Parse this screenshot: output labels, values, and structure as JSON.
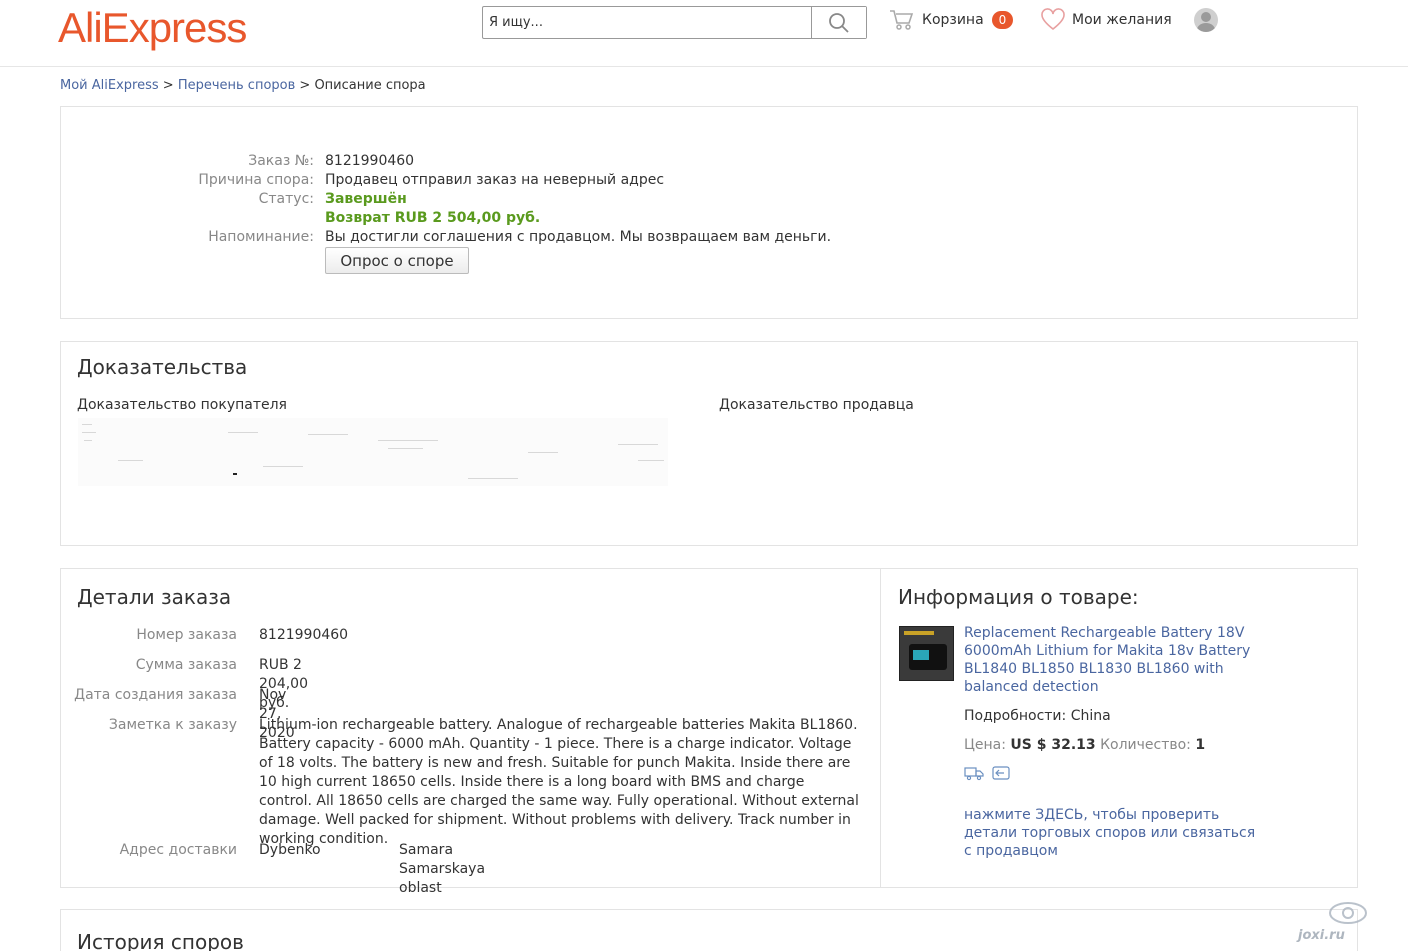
{
  "header": {
    "logo": "AliExpress",
    "search_placeholder": "Я ищу...",
    "cart_label": "Корзина",
    "cart_count": "0",
    "wishlist_label": "Мои желания"
  },
  "breadcrumb": {
    "item1": "Мой AliExpress",
    "sep1": " > ",
    "item2": "Перечень споров",
    "sep2": " > ",
    "current": "Описание спора"
  },
  "dispute": {
    "order_label": "Заказ №:",
    "order_value": "8121990460",
    "reason_label": "Причина спора:",
    "reason_value": "Продавец отправил заказ на неверный адрес",
    "status_label": "Статус:",
    "status_value": "Завершён",
    "refund_value": "Возврат RUB 2 504,00 руб.",
    "reminder_label": "Напоминание:",
    "reminder_value": "Вы достигли соглашения с продавцом. Мы возвращаем вам деньги.",
    "survey_button": "Опрос о споре"
  },
  "evidence": {
    "title": "Доказательства",
    "buyer_label": "Доказательство покупателя",
    "seller_label": "Доказательство продавца"
  },
  "order_details": {
    "title": "Детали заказа",
    "rows": [
      {
        "label": "Номер заказа",
        "value": "8121990460"
      },
      {
        "label": "Сумма заказа",
        "value": "RUB 2 204,00 руб."
      },
      {
        "label": "Дата создания заказа",
        "value": "Nov 27, 2020"
      },
      {
        "label": "Заметка к заказу",
        "value": "Lithium-ion rechargeable battery. Analogue of rechargeable batteries Makita BL1860. Battery capacity - 6000 mAh. Quantity - 1 piece. There is a charge indicator. Voltage of 18 volts. The battery is new and fresh. Suitable for punch Makita. Inside there are 10 high current 18650 cells. Inside there is a long board with BMS and charge control. All 18650 cells are charged the same way. Fully operational. Without external damage. Well packed for shipment. Without problems with delivery. Track number in working condition."
      },
      {
        "label": "Адрес доставки",
        "value": "Dybenko",
        "value2": "Samara Samarskaya oblast"
      }
    ]
  },
  "product": {
    "title": "Информация о товаре:",
    "name": "Replacement Rechargeable Battery 18V 6000mAh Lithium for Makita 18v Battery BL1840 BL1850 BL1830 BL1860 with balanced detection",
    "details_label": "Подробности:",
    "details_value": "China",
    "price_label": "Цена:",
    "price_value": "US $ 32.13",
    "qty_label": "Количество:",
    "qty_value": "1",
    "help_link": "нажмите ЗДЕСЬ, чтобы проверить детали торговых споров или связаться с продавцом"
  },
  "history": {
    "title": "История споров"
  },
  "watermark": "joxi.ru",
  "colors": {
    "brand": "#e8572c",
    "link": "#4a66a0",
    "success": "#5a9a1e"
  }
}
